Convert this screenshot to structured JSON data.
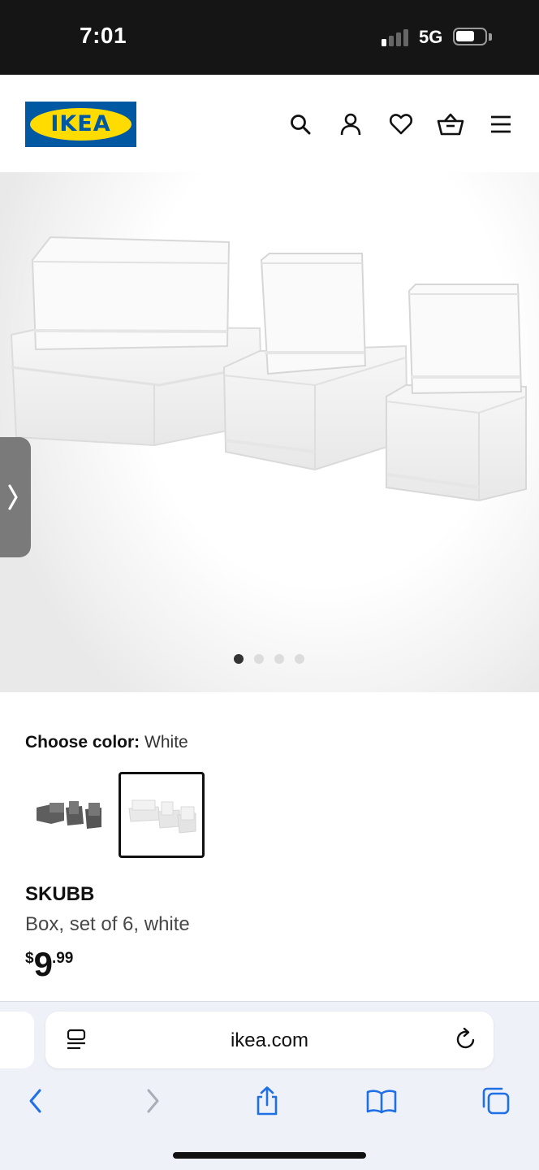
{
  "status_bar": {
    "time": "7:01",
    "network": "5G",
    "signal_bars_active": 1,
    "signal_bars_total": 4,
    "battery_level": 0.6
  },
  "header": {
    "logo_text": "IKEA",
    "brand_colors": {
      "blue": "#0058a3",
      "yellow": "#ffdb00"
    },
    "icons": [
      "search-icon",
      "account-icon",
      "heart-icon",
      "basket-icon",
      "menu-icon"
    ]
  },
  "gallery": {
    "image_count": 4,
    "active_index": 0,
    "side_tab_icon": "chevron-right-icon"
  },
  "color_chooser": {
    "label": "Choose color:",
    "selected_value": "White",
    "swatches": [
      {
        "color": "Gray",
        "selected": false
      },
      {
        "color": "White",
        "selected": true
      }
    ]
  },
  "product": {
    "name": "SKUBB",
    "description": "Box, set of 6, white",
    "price": {
      "currency": "$",
      "integer": "9",
      "decimal": ".99"
    }
  },
  "browser": {
    "url": "ikea.com",
    "accent_color": "#1f6fe5",
    "toolbar": [
      "back-icon",
      "forward-icon",
      "share-icon",
      "bookmarks-icon",
      "tabs-icon"
    ]
  }
}
